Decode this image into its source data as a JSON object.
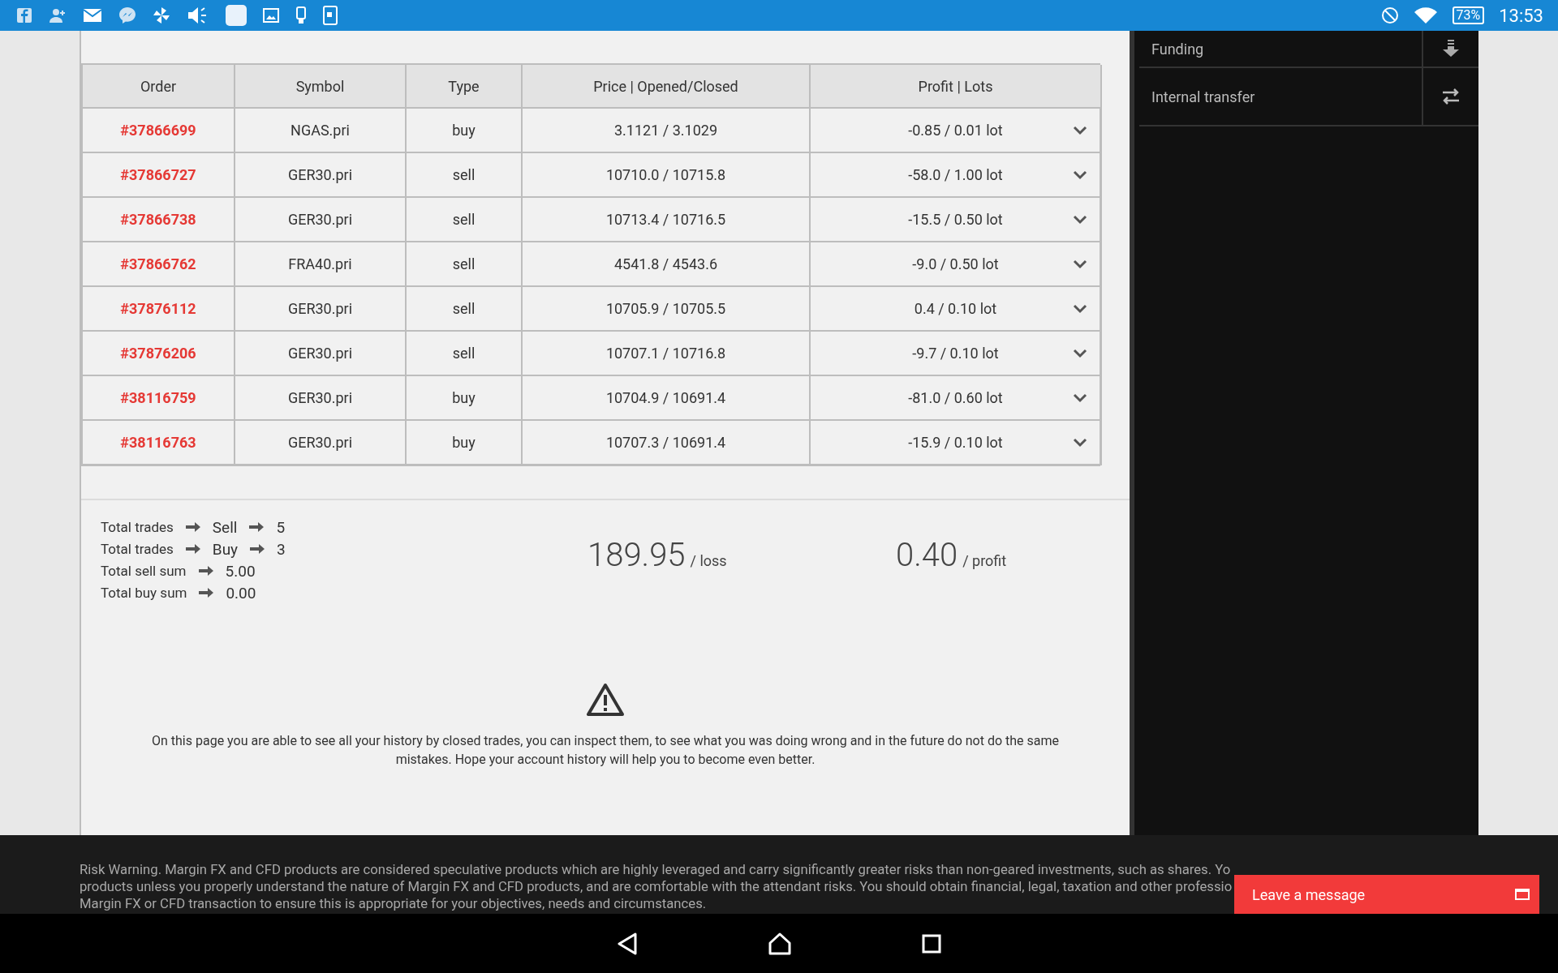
{
  "status_bar": {
    "battery": "73%",
    "time": "13:53"
  },
  "side_menu": [
    {
      "label": "Funding",
      "kind": "download"
    },
    {
      "label": "Internal transfer",
      "kind": "transfer"
    }
  ],
  "table": {
    "columns": [
      "Order",
      "Symbol",
      "Type",
      "Price | Opened/Closed",
      "Profit | Lots"
    ],
    "rows": [
      {
        "order": "#37866699",
        "symbol": "NGAS.pri",
        "type": "buy",
        "price": "3.1121 / 3.1029",
        "profit": "-0.85 / 0.01 lot"
      },
      {
        "order": "#37866727",
        "symbol": "GER30.pri",
        "type": "sell",
        "price": "10710.0 / 10715.8",
        "profit": "-58.0 / 1.00 lot"
      },
      {
        "order": "#37866738",
        "symbol": "GER30.pri",
        "type": "sell",
        "price": "10713.4 / 10716.5",
        "profit": "-15.5 / 0.50 lot"
      },
      {
        "order": "#37866762",
        "symbol": "FRA40.pri",
        "type": "sell",
        "price": "4541.8 / 4543.6",
        "profit": "-9.0 / 0.50 lot"
      },
      {
        "order": "#37876112",
        "symbol": "GER30.pri",
        "type": "sell",
        "price": "10705.9 / 10705.5",
        "profit": "0.4 / 0.10 lot"
      },
      {
        "order": "#37876206",
        "symbol": "GER30.pri",
        "type": "sell",
        "price": "10707.1 / 10716.8",
        "profit": "-9.7 / 0.10 lot"
      },
      {
        "order": "#38116759",
        "symbol": "GER30.pri",
        "type": "buy",
        "price": "10704.9 / 10691.4",
        "profit": "-81.0 / 0.60 lot"
      },
      {
        "order": "#38116763",
        "symbol": "GER30.pri",
        "type": "buy",
        "price": "10707.3 / 10691.4",
        "profit": "-15.9 / 0.10 lot"
      }
    ]
  },
  "summary": {
    "stats": [
      {
        "parts": [
          "Total trades",
          "Sell",
          "5"
        ]
      },
      {
        "parts": [
          "Total trades",
          "Buy",
          "3"
        ]
      },
      {
        "parts": [
          "Total sell sum",
          "5.00"
        ]
      },
      {
        "parts": [
          "Total buy sum",
          "0.00"
        ]
      }
    ],
    "loss": {
      "value": "189.95",
      "label": "/ loss"
    },
    "profit": {
      "value": "0.40",
      "label": "/ profit"
    }
  },
  "notice": "On this page you are able to see all your history by closed trades, you can inspect them, to see what you was doing wrong and in the future do not do the same mistakes. Hope your account history will help you to become even better.",
  "risk_warning": [
    "Risk Warning. Margin FX and CFD products are considered speculative products which are highly leveraged and carry significantly greater risks than non-geared investments, such as shares. Yo",
    "products unless you properly understand the nature of Margin FX and CFD products, and are comfortable with the attendant risks. You should obtain financial, legal, taxation and other professio",
    "Margin FX or CFD transaction to ensure this is appropriate for your objectives, needs and circumstances."
  ],
  "chat_button": "Leave a message"
}
